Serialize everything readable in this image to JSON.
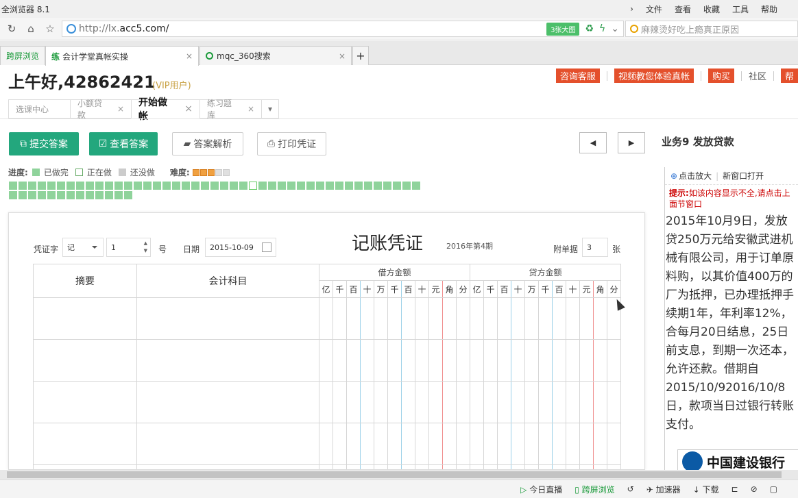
{
  "browser": {
    "title": "全浏览器 8.1",
    "menu": [
      "文件",
      "查看",
      "收藏",
      "工具",
      "帮助"
    ],
    "url_prefix": "http://lx.",
    "url_host": "acc5.com/",
    "bigimg": "3张大图",
    "search_placeholder": "麻辣烫好吃上瘾真正原因",
    "tabs": [
      {
        "label": "跨屏浏览"
      },
      {
        "label": "会计学堂真帐实操",
        "icon_char": "练"
      },
      {
        "label": "mqc_360搜索"
      }
    ],
    "newtab": "+"
  },
  "header": {
    "greeting": "上午好,42862421",
    "vip": "(VIP用户)",
    "links": {
      "consult": "咨询客服",
      "video": "视频教您体验真帐",
      "buy": "购买",
      "community": "社区",
      "more": "帮"
    }
  },
  "subtabs": [
    {
      "label": "选课中心"
    },
    {
      "label": "小额贷款"
    },
    {
      "label": "开始做帐"
    },
    {
      "label": "练习题库"
    }
  ],
  "toolbar": {
    "submit": "提交答案",
    "view": "查看答案",
    "analysis": "答案解析",
    "print": "打印凭证",
    "business": "业务9  发放贷款"
  },
  "progress": {
    "label": "进度:",
    "done": "已做完",
    "doing": "正在做",
    "todo": "还没做",
    "difficulty_label": "难度:",
    "difficulty": 3,
    "difficulty_max": 5,
    "total": 56,
    "current": 26
  },
  "voucher": {
    "title": "记账凭证",
    "period": "2016年第4期",
    "word_label": "凭证字",
    "word": "记",
    "number": "1",
    "number_unit": "号",
    "date_label": "日期",
    "date": "2015-10-09",
    "attach_label": "附单据",
    "attach": "3",
    "attach_unit": "张",
    "col_summary": "摘要",
    "col_account": "会计科目",
    "col_debit": "借方金额",
    "col_credit": "贷方金额",
    "digits": [
      "亿",
      "千",
      "百",
      "十",
      "万",
      "千",
      "百",
      "十",
      "元",
      "角",
      "分"
    ]
  },
  "sidebar": {
    "zoom": "点击放大",
    "newwin": "新窗口打开",
    "tip_bold": "提示:",
    "tip": "如该内容显示不全,请点击上面节窗口",
    "text": "2015年10月9日，发放贷250万元给安徽武进机械有限公司，用于订单原料购，以其价值400万的厂为抵押，已办理抵押手续期1年，年利率12%，合每月20日结息，25日前支息，到期一次还本，允许还款。借期自2015/10/92016/10/8日，款项当日过银行转账支付。",
    "bank": "中国建设银行"
  },
  "statusbar": {
    "live": "今日直播",
    "cross": "跨屏浏览",
    "speed": "加速器",
    "download": "下载"
  }
}
